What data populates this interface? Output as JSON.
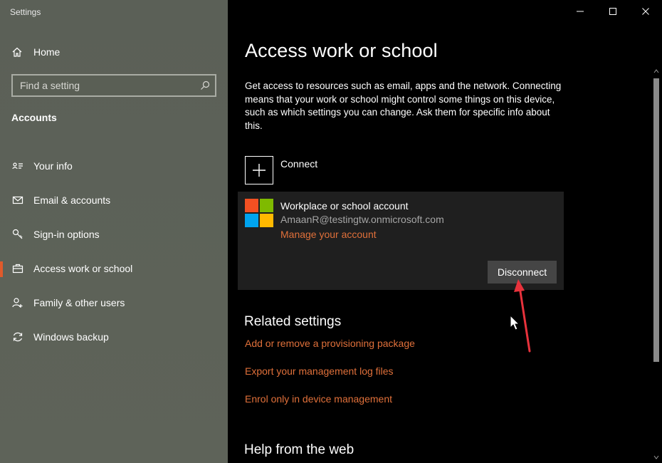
{
  "app": {
    "title": "Settings"
  },
  "sidebar": {
    "home_label": "Home",
    "search_placeholder": "Find a setting",
    "section_title": "Accounts",
    "items": [
      {
        "label": "Your info",
        "icon": "contact-card-icon"
      },
      {
        "label": "Email & accounts",
        "icon": "mail-icon"
      },
      {
        "label": "Sign-in options",
        "icon": "key-icon"
      },
      {
        "label": "Access work or school",
        "icon": "briefcase-icon",
        "active": true
      },
      {
        "label": "Family & other users",
        "icon": "person-add-icon"
      },
      {
        "label": "Windows backup",
        "icon": "sync-icon"
      }
    ]
  },
  "main": {
    "title": "Access work or school",
    "description": "Get access to resources such as email, apps and the network. Connecting means that your work or school might control some things on this device, such as which settings you can change. Ask them for specific info about this.",
    "connect_label": "Connect",
    "account": {
      "name": "Workplace or school account",
      "email": "AmaanR@testingtw.onmicrosoft.com",
      "manage_link": "Manage your account",
      "disconnect_label": "Disconnect"
    },
    "related_title": "Related settings",
    "related_links": [
      "Add or remove a provisioning package",
      "Export your management log files",
      "Enrol only in device management"
    ],
    "help_title": "Help from the web"
  },
  "colors": {
    "sidebar_bg": "#5d6257",
    "accent": "#e05a2b",
    "link": "#e0703a",
    "card_bg": "#1f1f1f",
    "button_bg": "#454545",
    "annotation_arrow": "#e8323c",
    "ms_logo": [
      "#f25022",
      "#7fba00",
      "#00a4ef",
      "#ffb900"
    ]
  }
}
